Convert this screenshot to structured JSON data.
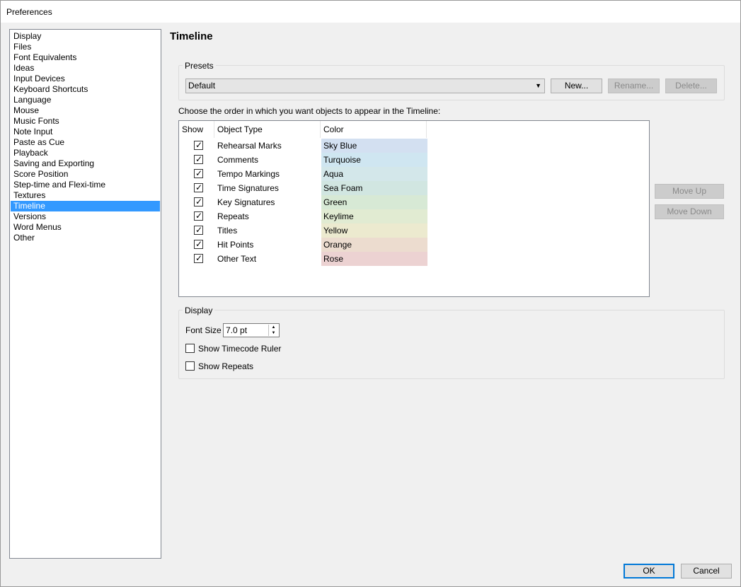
{
  "window": {
    "title": "Preferences"
  },
  "sidebar": {
    "items": [
      {
        "label": "Display",
        "selected": false
      },
      {
        "label": "Files",
        "selected": false
      },
      {
        "label": "Font Equivalents",
        "selected": false
      },
      {
        "label": "Ideas",
        "selected": false
      },
      {
        "label": "Input Devices",
        "selected": false
      },
      {
        "label": "Keyboard Shortcuts",
        "selected": false
      },
      {
        "label": "Language",
        "selected": false
      },
      {
        "label": "Mouse",
        "selected": false
      },
      {
        "label": "Music Fonts",
        "selected": false
      },
      {
        "label": "Note Input",
        "selected": false
      },
      {
        "label": "Paste as Cue",
        "selected": false
      },
      {
        "label": "Playback",
        "selected": false
      },
      {
        "label": "Saving and Exporting",
        "selected": false
      },
      {
        "label": "Score Position",
        "selected": false
      },
      {
        "label": "Step-time and Flexi-time",
        "selected": false
      },
      {
        "label": "Textures",
        "selected": false
      },
      {
        "label": "Timeline",
        "selected": true
      },
      {
        "label": "Versions",
        "selected": false
      },
      {
        "label": "Word Menus",
        "selected": false
      },
      {
        "label": "Other",
        "selected": false
      }
    ]
  },
  "page": {
    "title": "Timeline"
  },
  "presets": {
    "group_label": "Presets",
    "selected": "Default",
    "new_label": "New...",
    "rename_label": "Rename...",
    "delete_label": "Delete..."
  },
  "instructions": "Choose the order in which you want objects to appear in the Timeline:",
  "table": {
    "headers": {
      "show": "Show",
      "object_type": "Object Type",
      "color": "Color"
    },
    "rows": [
      {
        "show": true,
        "object_type": "Rehearsal Marks",
        "color": "Sky Blue",
        "swatch": "#d3e0f1"
      },
      {
        "show": true,
        "object_type": "Comments",
        "color": "Turquoise",
        "swatch": "#cfe6f1"
      },
      {
        "show": true,
        "object_type": "Tempo Markings",
        "color": "Aqua",
        "swatch": "#d3e7ea"
      },
      {
        "show": true,
        "object_type": "Time Signatures",
        "color": "Sea Foam",
        "swatch": "#d1e6e1"
      },
      {
        "show": true,
        "object_type": "Key Signatures",
        "color": "Green",
        "swatch": "#d7e9d5"
      },
      {
        "show": true,
        "object_type": "Repeats",
        "color": "Keylime",
        "swatch": "#e1ebd2"
      },
      {
        "show": true,
        "object_type": "Titles",
        "color": "Yellow",
        "swatch": "#eceacf"
      },
      {
        "show": true,
        "object_type": "Hit Points",
        "color": "Orange",
        "swatch": "#ecdccf"
      },
      {
        "show": true,
        "object_type": "Other Text",
        "color": "Rose",
        "swatch": "#ecd2d2"
      }
    ]
  },
  "move": {
    "up_label": "Move Up",
    "down_label": "Move Down"
  },
  "display": {
    "group_label": "Display",
    "font_size_label": "Font Size",
    "font_size_value": "7.0 pt",
    "show_timecode_label": "Show Timecode Ruler",
    "show_timecode": false,
    "show_repeats_label": "Show Repeats",
    "show_repeats": false
  },
  "footer": {
    "ok_label": "OK",
    "cancel_label": "Cancel"
  }
}
